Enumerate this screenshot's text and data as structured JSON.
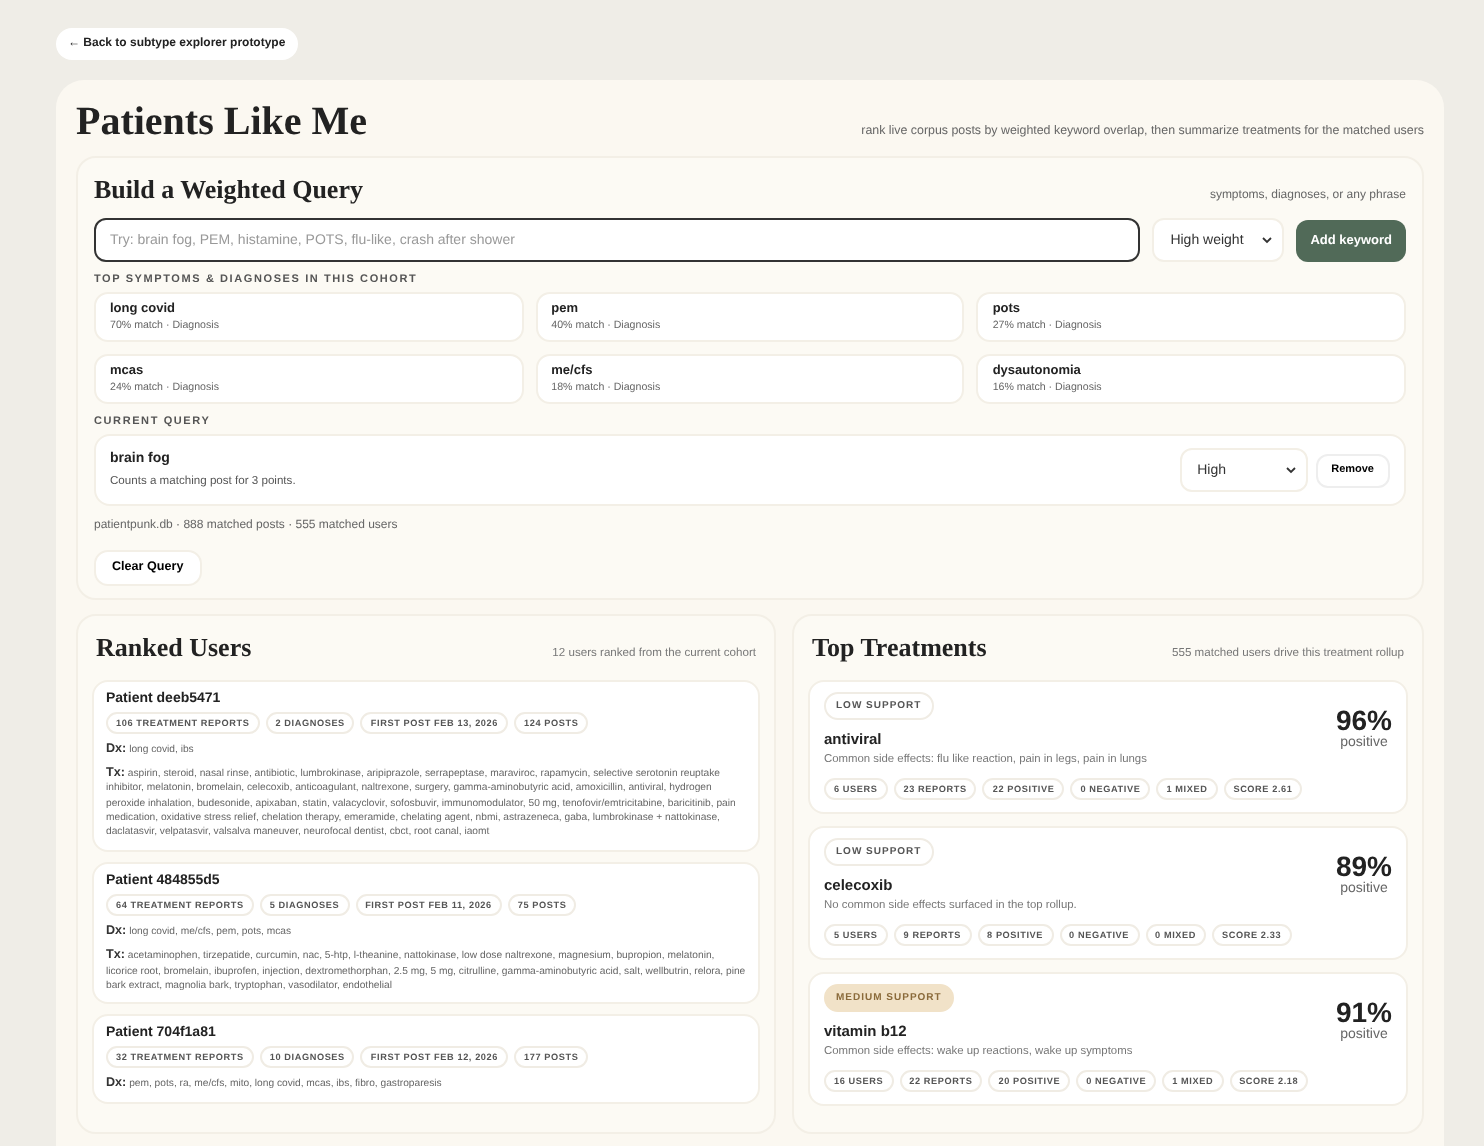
{
  "back_link": "← Back to subtype explorer prototype",
  "title": "Patients Like Me",
  "subtitle": "rank live corpus posts by weighted keyword overlap, then summarize treatments for the matched users",
  "query_builder": {
    "title": "Build a Weighted Query",
    "hint": "symptoms, diagnoses, or any phrase",
    "placeholder": "Try: brain fog, PEM, histamine, POTS, flu-like, crash after shower",
    "weight": "High weight",
    "add_button": "Add keyword",
    "cohort_label": "TOP SYMPTOMS & DIAGNOSES IN THIS COHORT",
    "cohort_terms": [
      {
        "name": "long covid",
        "detail": "70% match · Diagnosis"
      },
      {
        "name": "pem",
        "detail": "40% match · Diagnosis"
      },
      {
        "name": "pots",
        "detail": "27% match · Diagnosis"
      },
      {
        "name": "mcas",
        "detail": "24% match · Diagnosis"
      },
      {
        "name": "me/cfs",
        "detail": "18% match · Diagnosis"
      },
      {
        "name": "dysautonomia",
        "detail": "16% match · Diagnosis"
      }
    ],
    "current_label": "CURRENT QUERY",
    "current_terms": [
      {
        "name": "brain fog",
        "detail": "Counts a matching post for 3 points.",
        "weight": "High",
        "remove": "Remove"
      }
    ],
    "stats": "patientpunk.db · 888 matched posts · 555 matched users",
    "clear_button": "Clear Query"
  },
  "ranked_users": {
    "title": "Ranked Users",
    "note": "12 users ranked from the current cohort",
    "patients": [
      {
        "name": "Patient deeb5471",
        "chips": [
          "106 TREATMENT REPORTS",
          "2 DIAGNOSES",
          "FIRST POST FEB 13, 2026",
          "124 POSTS"
        ],
        "dx": "**Dx:** long covid, ibs",
        "tx": "**Tx:** aspirin, steroid, nasal rinse, antibiotic, lumbrokinase, aripiprazole, serrapeptase, maraviroc, rapamycin, selective serotonin reuptake inhibitor, melatonin, bromelain, celecoxib, anticoagulant, naltrexone, surgery, gamma-aminobutyric acid, amoxicillin, antiviral, hydrogen peroxide inhalation, budesonide, apixaban, statin, valacyclovir, sofosbuvir, immunomodulator, 50 mg, tenofovir/emtricitabine, baricitinib, pain medication, oxidative stress relief, chelation therapy, emeramide, chelating agent, nbmi, astrazeneca, gaba, lumbrokinase + nattokinase, daclatasvir, velpatasvir, valsalva maneuver, neurofocal dentist, cbct, root canal, iaomt"
      },
      {
        "name": "Patient 484855d5",
        "chips": [
          "64 TREATMENT REPORTS",
          "5 DIAGNOSES",
          "FIRST POST FEB 11, 2026",
          "75 POSTS"
        ],
        "dx": "**Dx:** long covid, me/cfs, pem, pots, mcas",
        "tx": "**Tx:** acetaminophen, tirzepatide, curcumin, nac, 5-htp, l-theanine, nattokinase, low dose naltrexone, magnesium, bupropion, melatonin, licorice root, bromelain, ibuprofen, injection, dextromethorphan, 2.5 mg, 5 mg, citrulline, gamma-aminobutyric acid, salt, wellbutrin, relora, pine bark extract, magnolia bark, tryptophan, vasodilator, endothelial"
      },
      {
        "name": "Patient 704f1a81",
        "chips": [
          "32 TREATMENT REPORTS",
          "10 DIAGNOSES",
          "FIRST POST FEB 12, 2026",
          "177 POSTS"
        ],
        "dx": "**Dx:** pem, pots, ra, me/cfs, mito, long covid, mcas, ibs, fibro, gastroparesis"
      }
    ]
  },
  "top_treatments": {
    "title": "Top Treatments",
    "note": "555 matched users drive this treatment rollup",
    "treatments": [
      {
        "kind": "low",
        "support": "LOW SUPPORT",
        "name": "antiviral",
        "side_effects": "Common side effects: flu like reaction, pain in legs, pain in lungs",
        "percent": "96%",
        "percent_label": "positive",
        "chips": [
          "6 USERS",
          "23 REPORTS",
          "22 POSITIVE",
          "0 NEGATIVE",
          "1 MIXED",
          "SCORE 2.61"
        ]
      },
      {
        "kind": "low",
        "support": "LOW SUPPORT",
        "name": "celecoxib",
        "side_effects": "No common side effects surfaced in the top rollup.",
        "percent": "89%",
        "percent_label": "positive",
        "chips": [
          "5 USERS",
          "9 REPORTS",
          "8 POSITIVE",
          "0 NEGATIVE",
          "0 MIXED",
          "SCORE 2.33"
        ]
      },
      {
        "kind": "medium",
        "support": "MEDIUM SUPPORT",
        "name": "vitamin b12",
        "side_effects": "Common side effects: wake up reactions, wake up symptoms",
        "percent": "91%",
        "percent_label": "positive",
        "chips": [
          "16 USERS",
          "22 REPORTS",
          "20 POSITIVE",
          "0 NEGATIVE",
          "1 MIXED",
          "SCORE 2.18"
        ]
      }
    ]
  }
}
